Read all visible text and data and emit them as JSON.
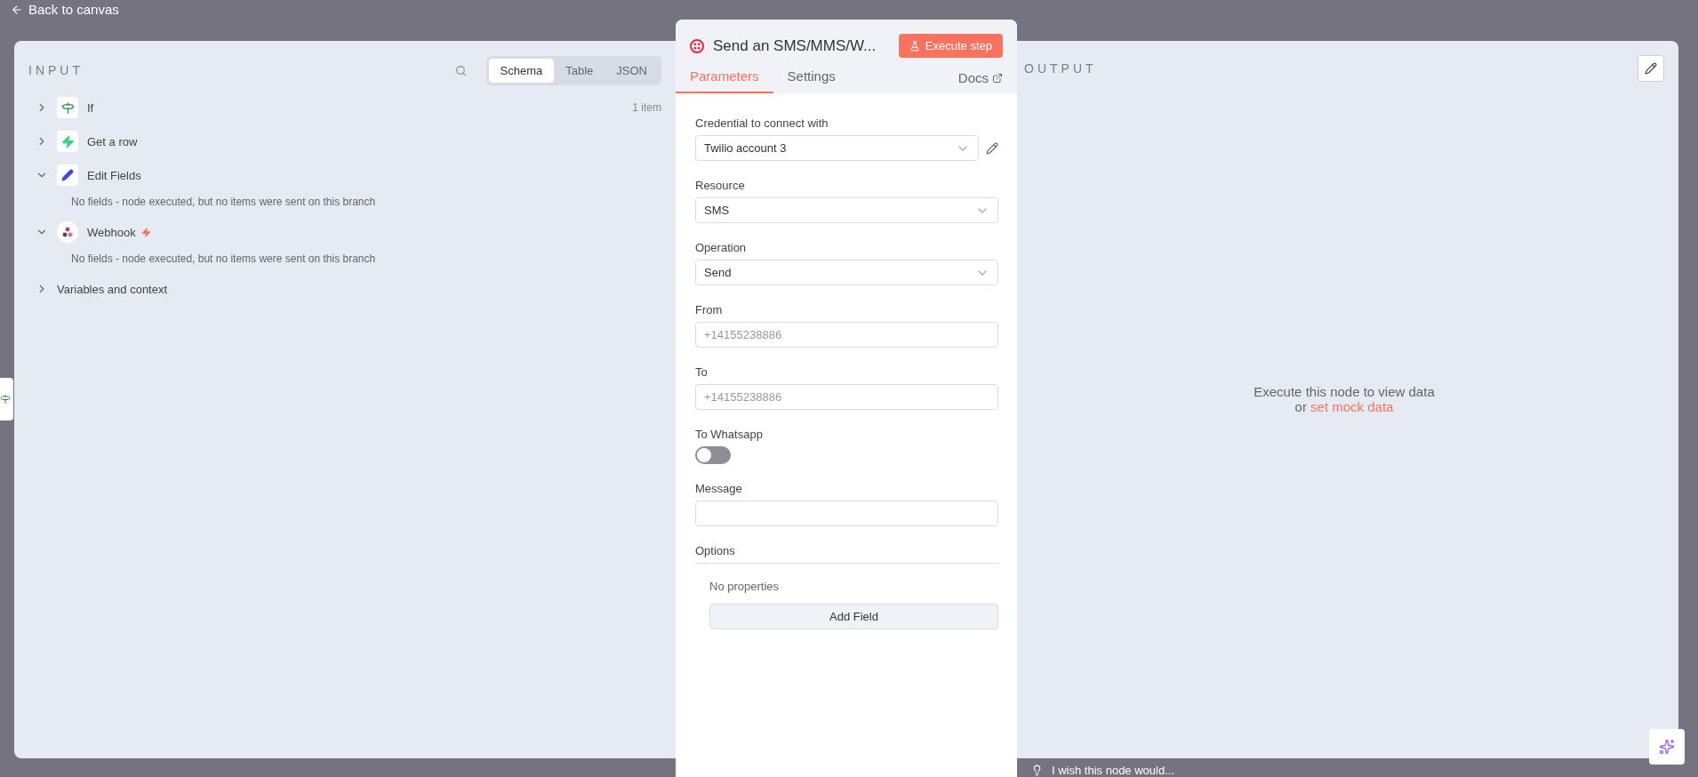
{
  "back_link": {
    "label": "Back to canvas"
  },
  "input": {
    "title": "INPUT",
    "view_tabs": [
      {
        "label": "Schema",
        "selected": true
      },
      {
        "label": "Table",
        "selected": false
      },
      {
        "label": "JSON",
        "selected": false
      }
    ],
    "nodes": [
      {
        "name": "If",
        "kind": "branch",
        "expanded": false,
        "count": "1 item"
      },
      {
        "name": "Get a row",
        "kind": "bolt",
        "expanded": false
      },
      {
        "name": "Edit Fields",
        "kind": "pencil",
        "expanded": true,
        "note": "No fields - node executed, but no items were sent on this branch"
      },
      {
        "name": "Webhook",
        "kind": "webhook",
        "expanded": true,
        "trigger": true,
        "note": "No fields - node executed, but no items were sent on this branch"
      },
      {
        "name": "Variables and context",
        "kind": "plain",
        "expanded": false
      }
    ]
  },
  "node_panel": {
    "title": "Send an SMS/MMS/W...",
    "execute_button": "Execute step",
    "tabs": [
      {
        "label": "Parameters",
        "selected": true
      },
      {
        "label": "Settings",
        "selected": false
      }
    ],
    "docs_link": "Docs",
    "fields": [
      {
        "kind": "select",
        "label": "Credential to connect with",
        "value": "Twilio account 3",
        "editable": true
      },
      {
        "kind": "select",
        "label": "Resource",
        "value": "SMS"
      },
      {
        "kind": "select",
        "label": "Operation",
        "value": "Send"
      },
      {
        "kind": "text",
        "label": "From",
        "placeholder": "+14155238886"
      },
      {
        "kind": "text",
        "label": "To",
        "placeholder": "+14155238886"
      },
      {
        "kind": "toggle",
        "label": "To Whatsapp",
        "on": false
      },
      {
        "kind": "text",
        "label": "Message"
      }
    ],
    "options": {
      "label": "Options",
      "empty_text": "No properties",
      "add_button": "Add Field"
    }
  },
  "output": {
    "title": "OUTPUT",
    "empty_text": "Execute this node to view data",
    "link_prefix": "or",
    "link": "set mock data"
  },
  "feedback": {
    "placeholder": "I wish this node would..."
  }
}
